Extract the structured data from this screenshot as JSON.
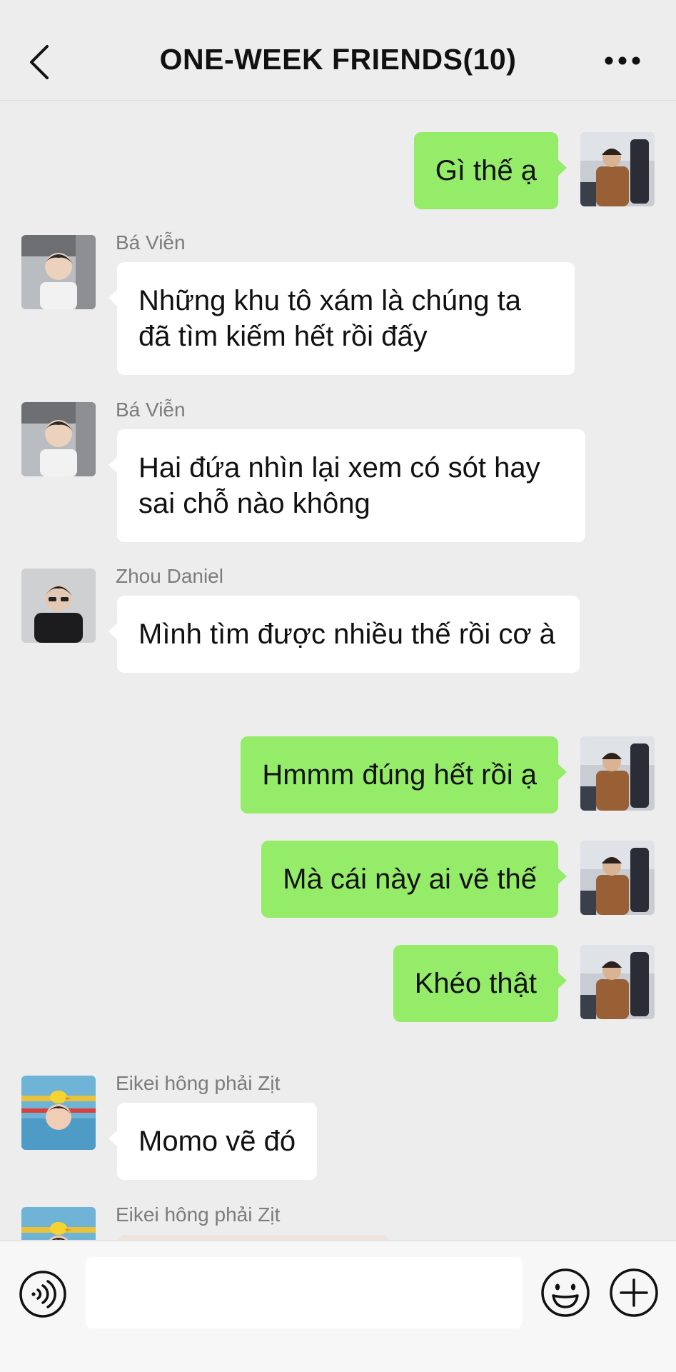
{
  "header": {
    "title": "ONE-WEEK FRIENDS(10)",
    "back_icon": "chevron-left-icon",
    "more_icon": "more-dots-icon"
  },
  "messages": [
    {
      "direction": "out",
      "text": "Gì thế ạ"
    },
    {
      "direction": "in",
      "sender": "Bá Viễn",
      "text": "Những khu tô xám là chúng ta đã tìm kiếm hết rồi đấy"
    },
    {
      "direction": "in",
      "sender": "Bá Viễn",
      "text": "Hai đứa nhìn lại xem có sót hay sai chỗ nào không"
    },
    {
      "direction": "in",
      "sender": "Zhou Daniel",
      "text": "Mình tìm được nhiều thế rồi cơ à"
    },
    {
      "direction": "out",
      "text": "Hmmm đúng hết rồi ạ"
    },
    {
      "direction": "out",
      "text": "Mà cái này ai vẽ thế"
    },
    {
      "direction": "out",
      "text": "Khéo thật"
    },
    {
      "direction": "in",
      "sender": "Eikei hông phải Zịt",
      "text": "Momo vẽ đó"
    },
    {
      "direction": "in",
      "sender": "Eikei hông phải Zịt",
      "type": "image"
    }
  ],
  "input_bar": {
    "voice_icon": "voice-icon",
    "emoji_icon": "emoji-icon",
    "plus_icon": "plus-icon",
    "input_value": ""
  },
  "colors": {
    "background": "#ededed",
    "outgoing_bubble": "#95ec69",
    "incoming_bubble": "#ffffff",
    "sender_name": "#7c7c7c"
  }
}
